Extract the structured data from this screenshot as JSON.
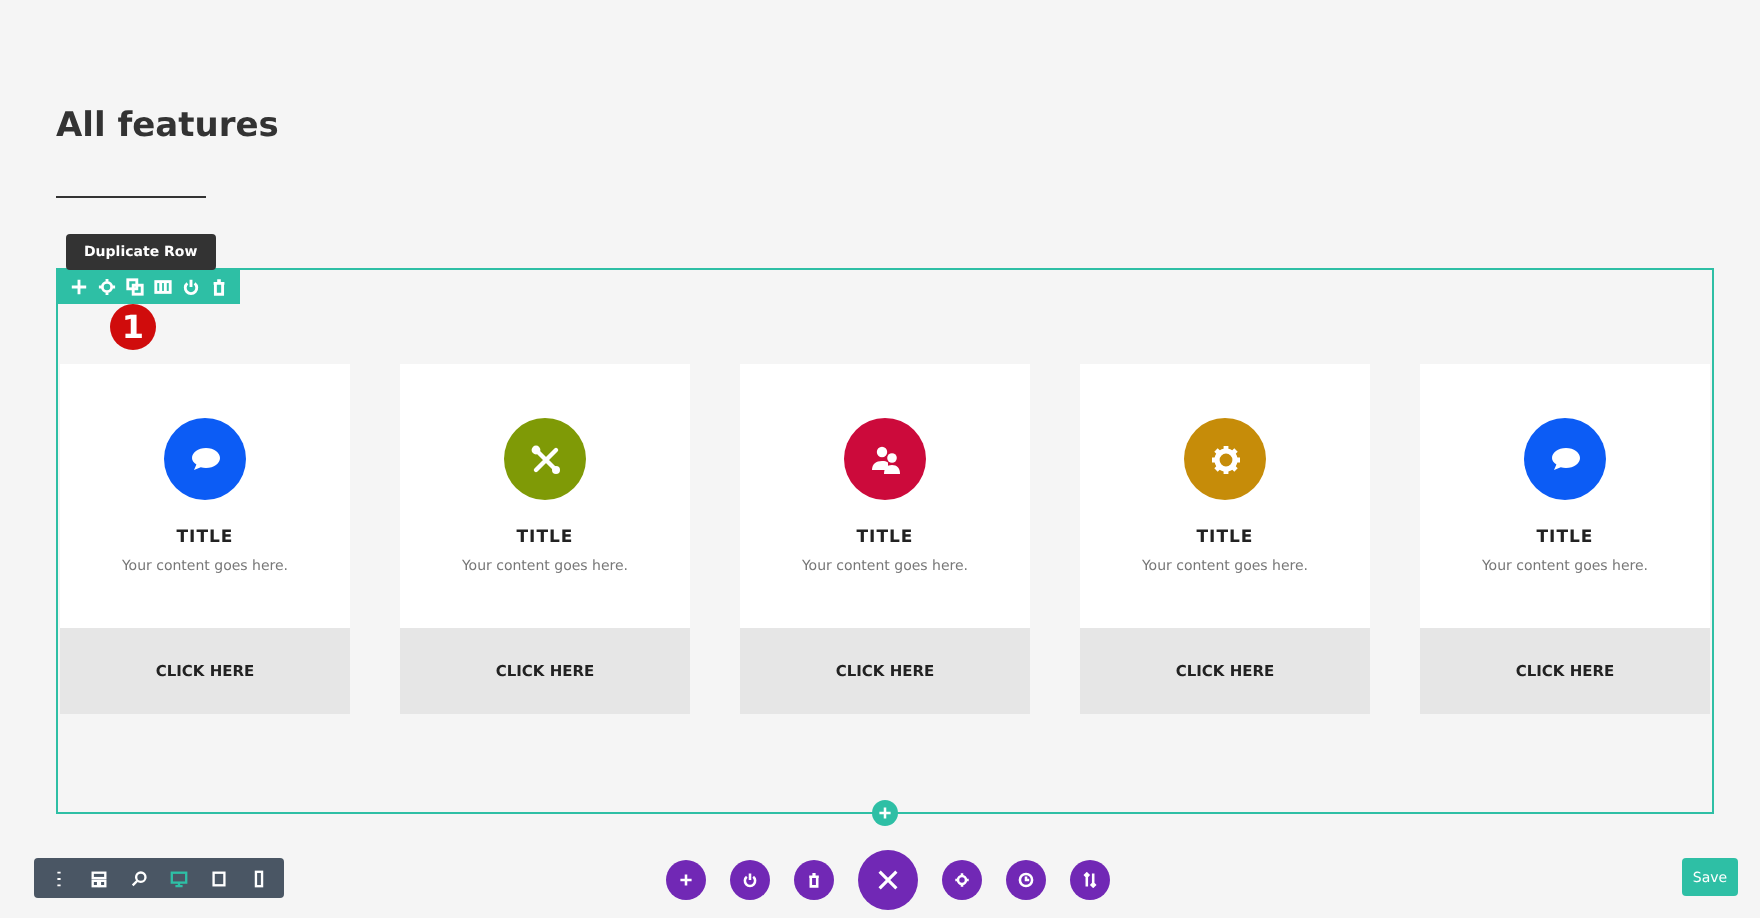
{
  "heading": "All features",
  "row_toolbar": {
    "tooltip": "Duplicate Row",
    "badge": "1",
    "tools": [
      {
        "kind": "add"
      },
      {
        "kind": "settings"
      },
      {
        "kind": "duplicate"
      },
      {
        "kind": "columns"
      },
      {
        "kind": "power"
      },
      {
        "kind": "delete"
      }
    ]
  },
  "cards": [
    {
      "kind": "chat",
      "color": "#0c5cf5",
      "title": "TITLE",
      "text": "Your content goes here.",
      "button": "CLICK HERE"
    },
    {
      "kind": "tools",
      "color": "#7f9a06",
      "title": "TITLE",
      "text": "Your content goes here.",
      "button": "CLICK HERE"
    },
    {
      "kind": "people",
      "color": "#cc0a3b",
      "title": "TITLE",
      "text": "Your content goes here.",
      "button": "CLICK HERE"
    },
    {
      "kind": "gear",
      "color": "#c68c09",
      "title": "TITLE",
      "text": "Your content goes here.",
      "button": "CLICK HERE"
    },
    {
      "kind": "chat",
      "color": "#0c5cf5",
      "title": "TITLE",
      "text": "Your content goes here.",
      "button": "CLICK HERE"
    }
  ],
  "view_modes": [
    {
      "kind": "menu",
      "selected": false
    },
    {
      "kind": "layout",
      "selected": false
    },
    {
      "kind": "zoom",
      "selected": false
    },
    {
      "kind": "desktop",
      "selected": true
    },
    {
      "kind": "tablet",
      "selected": false
    },
    {
      "kind": "phone",
      "selected": false
    }
  ],
  "page_actions": [
    {
      "kind": "add"
    },
    {
      "kind": "power"
    },
    {
      "kind": "delete"
    },
    {
      "kind": "close"
    },
    {
      "kind": "settings"
    },
    {
      "kind": "history"
    },
    {
      "kind": "sort"
    }
  ],
  "save_button": "Save"
}
